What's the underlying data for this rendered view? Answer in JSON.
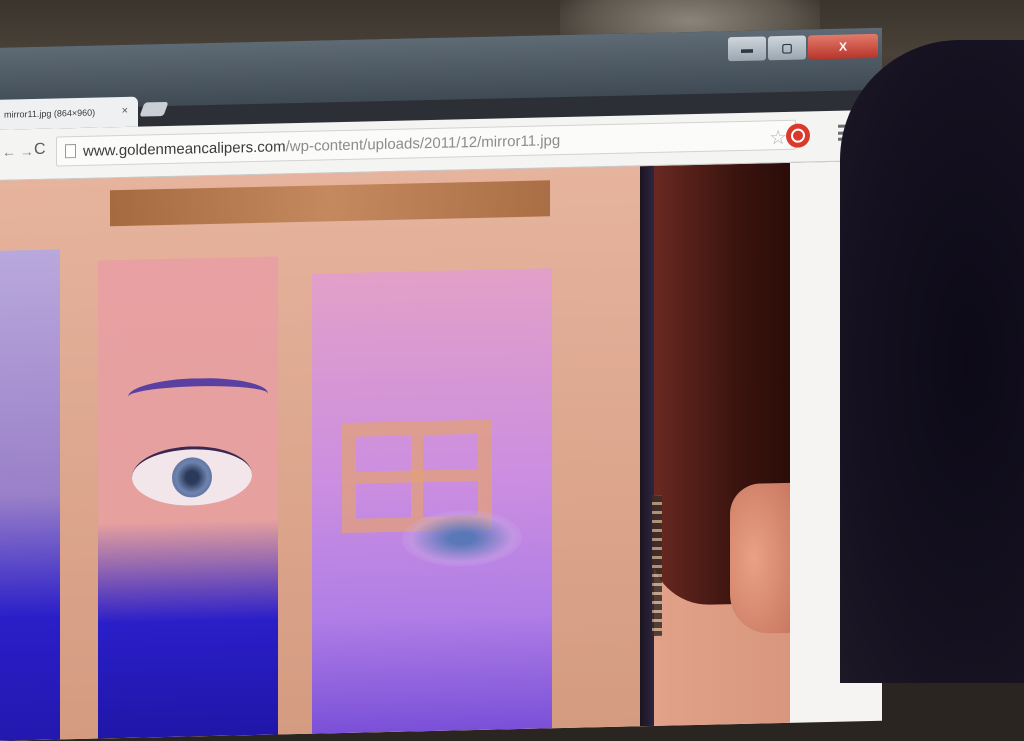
{
  "window": {
    "tab_title": "mirror11.jpg (864×960)",
    "tab_close": "×",
    "controls": {
      "minimize": "▬",
      "maximize": "▢",
      "close": "X"
    }
  },
  "toolbar": {
    "back_icon": "← →",
    "reload_icon": "C",
    "url_host": "www.goldenmeancalipers.com",
    "url_path": "/wp-content/uploads/2011/12/mirror11.jpg",
    "bookmark_icon": "☆"
  },
  "colors": {
    "close_button": "#c83a2e",
    "extension_icon": "#d93a2b",
    "photo_frame": "#e0a88f",
    "blue_floor": "#2a1ec8"
  },
  "icons": [
    "back-arrow-icon",
    "forward-arrow-icon",
    "reload-icon",
    "page-icon",
    "star-icon",
    "extension-icon",
    "menu-icon"
  ]
}
